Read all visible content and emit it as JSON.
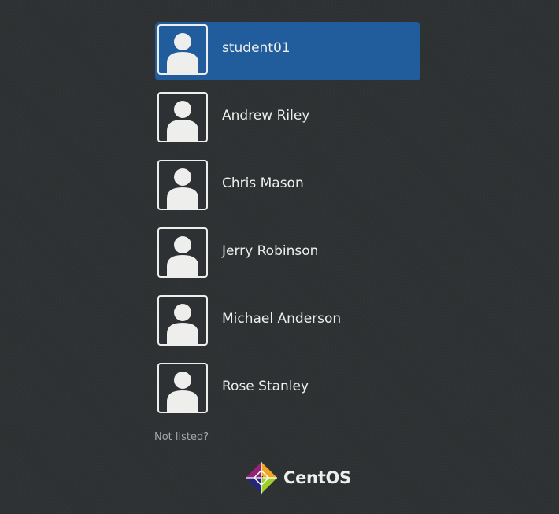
{
  "users": [
    {
      "name": "student01",
      "selected": true
    },
    {
      "name": "Andrew Riley",
      "selected": false
    },
    {
      "name": "Chris Mason",
      "selected": false
    },
    {
      "name": "Jerry Robinson",
      "selected": false
    },
    {
      "name": "Michael Anderson",
      "selected": false
    },
    {
      "name": "Rose Stanley",
      "selected": false
    }
  ],
  "not_listed_label": "Not listed?",
  "brand": {
    "text": "CentOS",
    "logo_icon": "centos-logo-icon"
  },
  "colors": {
    "background": "#2e3133",
    "selected_row": "#215d9c",
    "text": "#eeeeec",
    "muted_text": "#a3a7a8"
  }
}
